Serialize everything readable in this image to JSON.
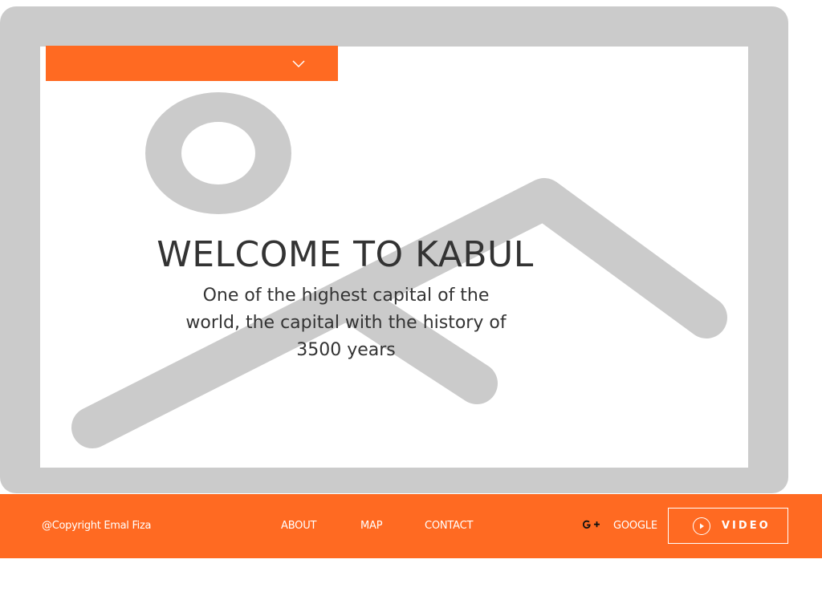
{
  "dropdown": {
    "selected_value": "",
    "icon": "chevron-down-icon"
  },
  "hero": {
    "placeholder_icon": "image-placeholder-icon",
    "title": "WELCOME TO KABUL",
    "subtitle": "One of the highest capital of the world, the capital with the history of 3500 years"
  },
  "footer": {
    "copyright": "@Copyright Emal Fiza",
    "nav": {
      "about": "ABOUT",
      "map": "MAP",
      "contact": "CONTACT"
    },
    "social": {
      "icon": "google-plus-icon",
      "label": "GOOGLE"
    },
    "video_button": {
      "icon": "play-icon",
      "label": "VIDEO"
    }
  },
  "colors": {
    "accent": "#ff6a22",
    "placeholder_gray": "#cbcbcb",
    "text_dark": "#333333",
    "background": "#ffffff"
  }
}
